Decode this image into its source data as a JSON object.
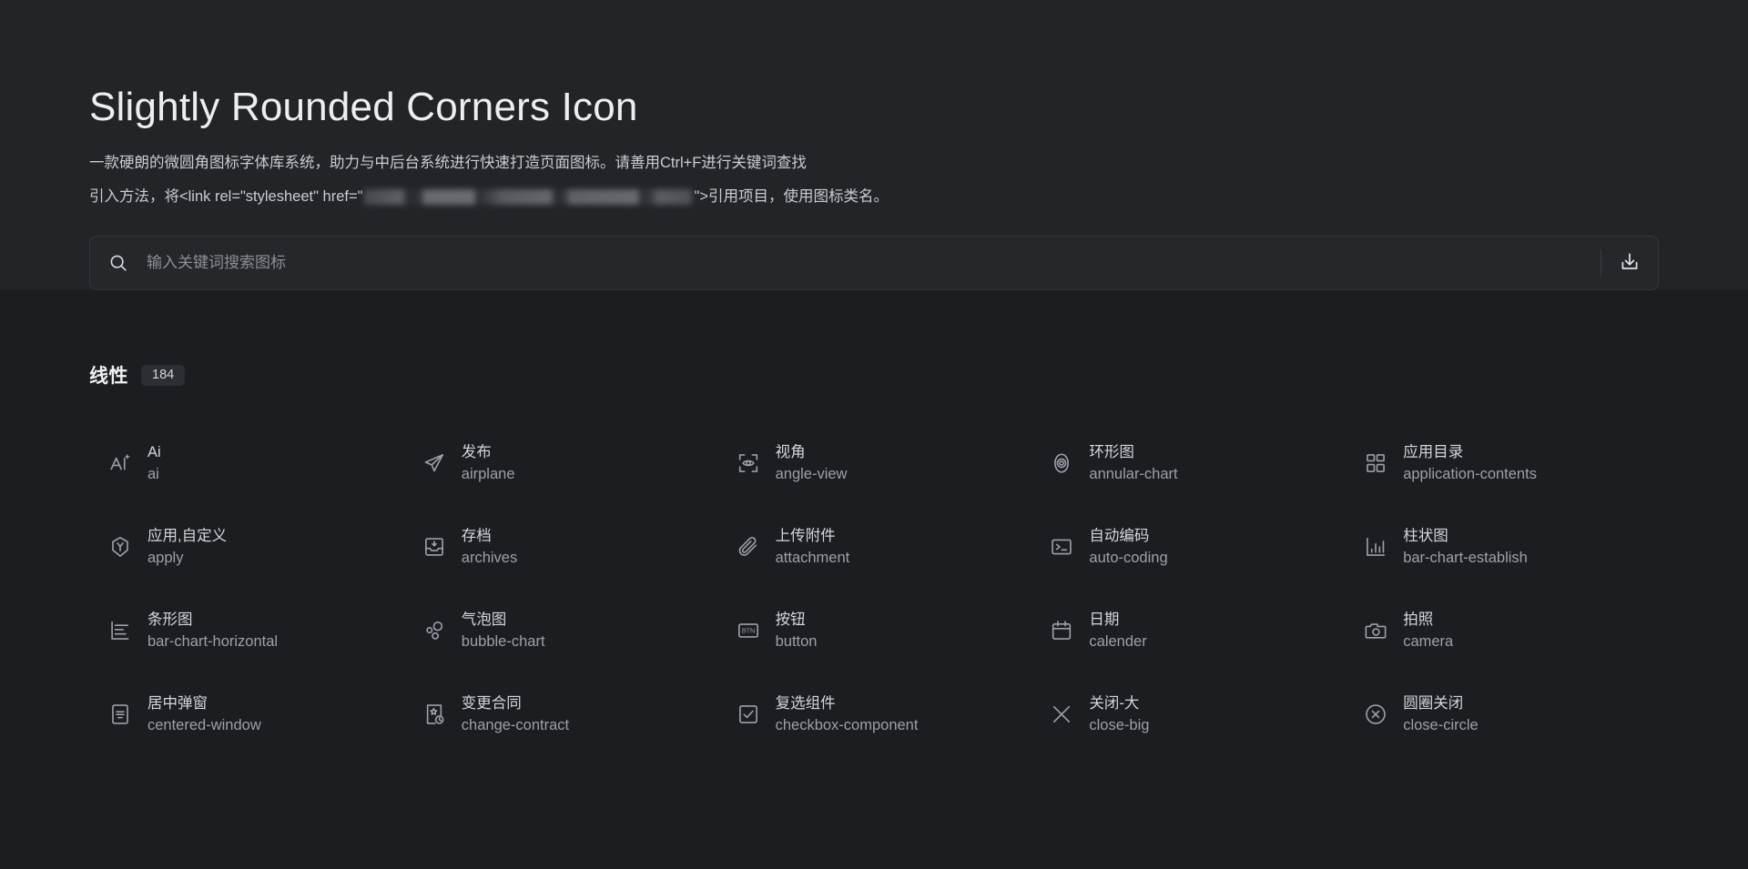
{
  "header": {
    "title": "Slightly Rounded Corners Icon",
    "description_line1": "一款硬朗的微圆角图标字体库系统，助力与中后台系统进行快速打造页面图标。请善用Ctrl+F进行关键词查找",
    "description_line2_prefix": "引入方法，将<link rel=\"stylesheet\" href=\"",
    "description_line2_suffix": "\">引用项目，使用图标类名。"
  },
  "search": {
    "placeholder": "输入关键词搜索图标",
    "value": "",
    "search_icon": "search-icon",
    "download_icon": "download-icon"
  },
  "section": {
    "title": "线性",
    "count": "184"
  },
  "icons": [
    {
      "icon": "ai-sparkle-icon",
      "cn": "Ai",
      "en": "ai"
    },
    {
      "icon": "paper-plane-icon",
      "cn": "发布",
      "en": "airplane"
    },
    {
      "icon": "eye-viewfinder-icon",
      "cn": "视角",
      "en": "angle-view"
    },
    {
      "icon": "annular-chart-icon",
      "cn": "环形图",
      "en": "annular-chart"
    },
    {
      "icon": "grid-squares-icon",
      "cn": "应用目录",
      "en": "application-contents"
    },
    {
      "icon": "hexagon-y-icon",
      "cn": "应用,自定义",
      "en": "apply"
    },
    {
      "icon": "archive-box-icon",
      "cn": "存档",
      "en": "archives"
    },
    {
      "icon": "paperclip-icon",
      "cn": "上传附件",
      "en": "attachment"
    },
    {
      "icon": "terminal-icon",
      "cn": "自动编码",
      "en": "auto-coding"
    },
    {
      "icon": "bar-chart-icon",
      "cn": "柱状图",
      "en": "bar-chart-establish"
    },
    {
      "icon": "bar-chart-horizontal-icon",
      "cn": "条形图",
      "en": "bar-chart-horizontal"
    },
    {
      "icon": "bubble-chart-icon",
      "cn": "气泡图",
      "en": "bubble-chart"
    },
    {
      "icon": "button-btn-icon",
      "cn": "按钮",
      "en": "button"
    },
    {
      "icon": "calendar-icon",
      "cn": "日期",
      "en": "calender"
    },
    {
      "icon": "camera-icon",
      "cn": "拍照",
      "en": "camera"
    },
    {
      "icon": "centered-window-icon",
      "cn": "居中弹窗",
      "en": "centered-window"
    },
    {
      "icon": "change-contract-icon",
      "cn": "变更合同",
      "en": "change-contract"
    },
    {
      "icon": "checkbox-icon",
      "cn": "复选组件",
      "en": "checkbox-component"
    },
    {
      "icon": "close-big-icon",
      "cn": "关闭-大",
      "en": "close-big"
    },
    {
      "icon": "close-circle-icon",
      "cn": "圆圈关闭",
      "en": "close-circle"
    }
  ],
  "colors": {
    "page_background": "#1e1f22",
    "top_band": "#232428",
    "lower_band": "#1c1d20",
    "search_background": "#26272b",
    "text_primary": "#e8e8e8",
    "text_secondary": "#9ba0a9",
    "icon_color": "#9aa0ab"
  }
}
